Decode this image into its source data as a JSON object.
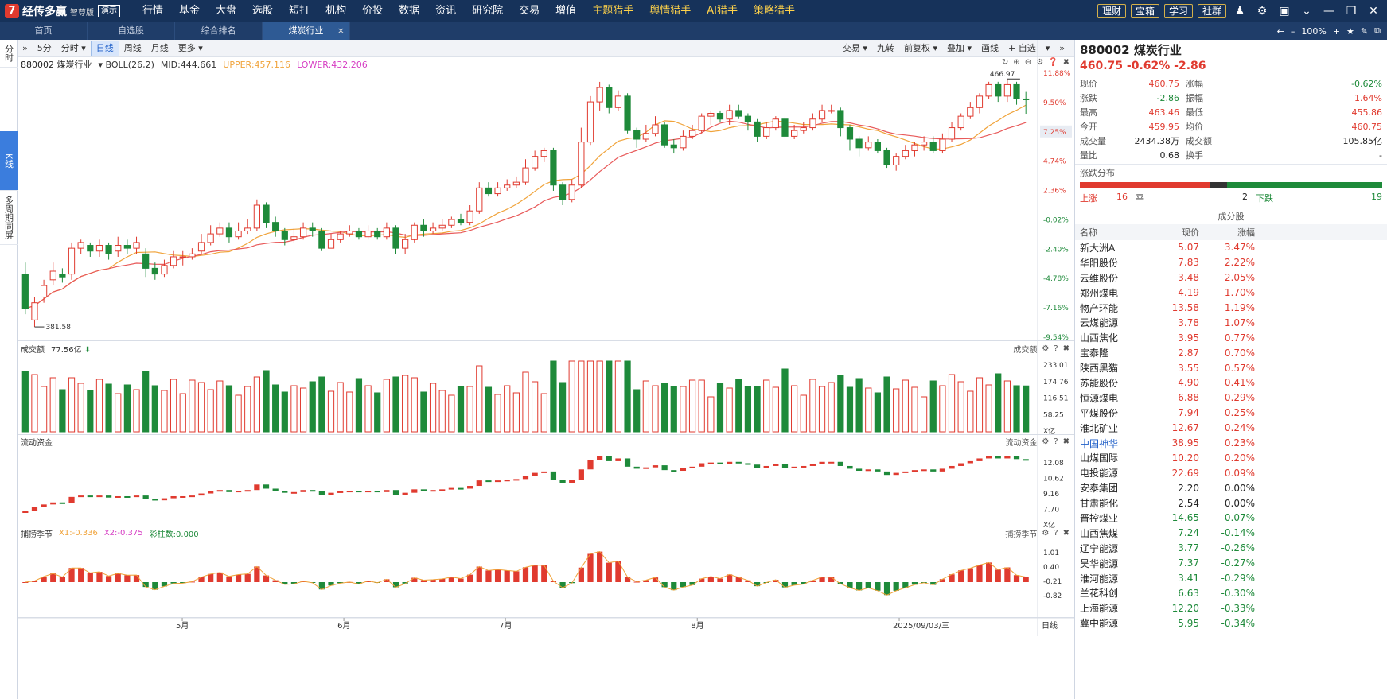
{
  "app": {
    "logo_glyph": "7",
    "name": "经传多赢",
    "edition": "智尊版",
    "demo_badge": "演示"
  },
  "nav": [
    "行情",
    "基金",
    "大盘",
    "选股",
    "短打",
    "机构",
    "价投",
    "数据",
    "资讯",
    "研究院",
    "交易",
    "增值",
    "主题猎手",
    "舆情猎手",
    "AI猎手",
    "策略猎手"
  ],
  "nav_highlight": [
    "主题猎手",
    "舆情猎手",
    "AI猎手",
    "策略猎手"
  ],
  "top_buttons": [
    "理财",
    "宝箱",
    "学习",
    "社群"
  ],
  "tabs": [
    {
      "label": "首页"
    },
    {
      "label": "自选股"
    },
    {
      "label": "综合排名"
    },
    {
      "label": "煤炭行业",
      "active": true
    }
  ],
  "tab_tools": {
    "zoom": "100%"
  },
  "left_side": [
    "分时",
    "K线",
    "多周期同屏"
  ],
  "chart_toolbar": {
    "left": [
      "»",
      "5分",
      "分时 ▾",
      "日线",
      "周线",
      "月线",
      "更多 ▾"
    ],
    "active": "日线",
    "right": [
      "交易 ▾",
      "九转",
      "前复权 ▾",
      "叠加 ▾",
      "画线",
      "+ 自选",
      "▾",
      "»"
    ]
  },
  "indicator": {
    "name": "880002 煤炭行业",
    "boll": "BOLL(26,2)",
    "mid": "MID:444.661",
    "upper": "UPPER:457.116",
    "lower": "LOWER:432.206"
  },
  "price_axis": [
    "11.88%",
    "9.50%",
    "7.25%",
    "4.74%",
    "2.36%",
    "-0.02%",
    "-2.40%",
    "-4.78%",
    "-7.16%",
    "-9.54%"
  ],
  "price_markers": {
    "high": "466.97",
    "low": "381.58"
  },
  "vol_panel": {
    "title": "成交额",
    "value": "77.56亿",
    "axis": [
      "233.01",
      "174.76",
      "116.51",
      "58.25",
      "X亿"
    ],
    "right_label": "成交额"
  },
  "flow_panel": {
    "title": "流动资金",
    "axis": [
      "12.08",
      "10.62",
      "9.16",
      "7.70",
      "X亿"
    ],
    "right_label": "流动资金"
  },
  "season_panel": {
    "title": "捕捞季节",
    "x1": "X1:-0.336",
    "x2": "X2:-0.375",
    "bar": "彩柱数:0.000",
    "axis": [
      "1.01",
      "0.40",
      "-0.21",
      "-0.82"
    ],
    "right_label": "捕捞季节"
  },
  "date_axis": [
    "5月",
    "6月",
    "7月",
    "8月",
    "2025/09/03/三"
  ],
  "period_label": "日线",
  "colors": {
    "up": "#e03a2f",
    "down": "#1e8a3a",
    "ma_orange": "#f0a33a",
    "ma_red": "#e85a5a",
    "accent": "#1f5fc8"
  },
  "right_panel": {
    "code_name": "880002 煤炭行业",
    "price_line": "460.75  -0.62%  -2.86",
    "quote": [
      {
        "k": "现价",
        "v": "460.75",
        "k2": "涨幅",
        "v2": "-0.62%"
      },
      {
        "k": "涨跌",
        "v": "-2.86",
        "k2": "振幅",
        "v2": "1.64%"
      },
      {
        "k": "最高",
        "v": "463.46",
        "k2": "最低",
        "v2": "455.86"
      },
      {
        "k": "今开",
        "v": "459.95",
        "k2": "均价",
        "v2": "460.75"
      },
      {
        "k": "成交量",
        "v": "2434.38万",
        "k2": "成交额",
        "v2": "105.85亿"
      },
      {
        "k": "量比",
        "v": "0.68",
        "k2": "换手",
        "v2": "-"
      }
    ],
    "dist_title": "涨跌分布",
    "dist": {
      "up_label": "上涨",
      "up": "16",
      "flat_label": "平",
      "flat": "2",
      "down_label": "下跌",
      "down": "19"
    },
    "comp_title": "成分股",
    "comp_cols": [
      "名称",
      "现价",
      "涨幅"
    ],
    "components": [
      {
        "name": "新大洲A",
        "price": "5.07",
        "chg": "3.47%"
      },
      {
        "name": "华阳股份",
        "price": "7.83",
        "chg": "2.22%"
      },
      {
        "name": "云维股份",
        "price": "3.48",
        "chg": "2.05%"
      },
      {
        "name": "郑州煤电",
        "price": "4.19",
        "chg": "1.70%"
      },
      {
        "name": "物产环能",
        "price": "13.58",
        "chg": "1.19%"
      },
      {
        "name": "云煤能源",
        "price": "3.78",
        "chg": "1.07%"
      },
      {
        "name": "山西焦化",
        "price": "3.95",
        "chg": "0.77%"
      },
      {
        "name": "宝泰隆",
        "price": "2.87",
        "chg": "0.70%"
      },
      {
        "name": "陕西黑猫",
        "price": "3.55",
        "chg": "0.57%"
      },
      {
        "name": "苏能股份",
        "price": "4.90",
        "chg": "0.41%"
      },
      {
        "name": "恒源煤电",
        "price": "6.88",
        "chg": "0.29%"
      },
      {
        "name": "平煤股份",
        "price": "7.94",
        "chg": "0.25%"
      },
      {
        "name": "淮北矿业",
        "price": "12.67",
        "chg": "0.24%"
      },
      {
        "name": "中国神华",
        "price": "38.95",
        "chg": "0.23%",
        "hl": true
      },
      {
        "name": "山煤国际",
        "price": "10.20",
        "chg": "0.20%"
      },
      {
        "name": "电投能源",
        "price": "22.69",
        "chg": "0.09%"
      },
      {
        "name": "安泰集团",
        "price": "2.20",
        "chg": "0.00%"
      },
      {
        "name": "甘肃能化",
        "price": "2.54",
        "chg": "0.00%"
      },
      {
        "name": "晋控煤业",
        "price": "14.65",
        "chg": "-0.07%"
      },
      {
        "name": "山西焦煤",
        "price": "7.24",
        "chg": "-0.14%"
      },
      {
        "name": "辽宁能源",
        "price": "3.77",
        "chg": "-0.26%"
      },
      {
        "name": "昊华能源",
        "price": "7.37",
        "chg": "-0.27%"
      },
      {
        "name": "淮河能源",
        "price": "3.41",
        "chg": "-0.29%"
      },
      {
        "name": "兰花科创",
        "price": "6.63",
        "chg": "-0.30%"
      },
      {
        "name": "上海能源",
        "price": "12.20",
        "chg": "-0.33%"
      },
      {
        "name": "冀中能源",
        "price": "5.95",
        "chg": "-0.34%"
      }
    ]
  },
  "chart_data": {
    "type": "candlestick",
    "title": "880002 煤炭行业",
    "period": "日线",
    "high": 466.97,
    "low": 381.58,
    "candles": [
      [
        400,
        388,
        404,
        386
      ],
      [
        384,
        390,
        392,
        381.58
      ],
      [
        392,
        396,
        398,
        390
      ],
      [
        398,
        401,
        404,
        396
      ],
      [
        400,
        399,
        402,
        397
      ],
      [
        400,
        409,
        411,
        398
      ],
      [
        409,
        411,
        412,
        407
      ],
      [
        410,
        408,
        411,
        406
      ],
      [
        408,
        410,
        412,
        406
      ],
      [
        410,
        407,
        411,
        405
      ],
      [
        408,
        410,
        413,
        406
      ],
      [
        410,
        409,
        412,
        407
      ],
      [
        409,
        411,
        413,
        407
      ],
      [
        407,
        402,
        409,
        399
      ],
      [
        402,
        400,
        404,
        398
      ],
      [
        400,
        403,
        405,
        399
      ],
      [
        403,
        406,
        408,
        402
      ],
      [
        406,
        406,
        408,
        403
      ],
      [
        406,
        407,
        409,
        405
      ],
      [
        408,
        411,
        414,
        407
      ],
      [
        411,
        414,
        417,
        410
      ],
      [
        414,
        416,
        418,
        413
      ],
      [
        416,
        413,
        418,
        411
      ],
      [
        413,
        415,
        418,
        412
      ],
      [
        415,
        416,
        419,
        414
      ],
      [
        416,
        424,
        426,
        415
      ],
      [
        424,
        418,
        425,
        416
      ],
      [
        418,
        415,
        420,
        413
      ],
      [
        415,
        412,
        416,
        410
      ],
      [
        412,
        413,
        416,
        411
      ],
      [
        413,
        416,
        418,
        412
      ],
      [
        416,
        415,
        418,
        413
      ],
      [
        415,
        409,
        416,
        408
      ],
      [
        409,
        412,
        414,
        410
      ],
      [
        412,
        414,
        415,
        411
      ],
      [
        414,
        415,
        417,
        413
      ],
      [
        415,
        413,
        416,
        412
      ],
      [
        413,
        415,
        417,
        412
      ],
      [
        415,
        413,
        416,
        412
      ],
      [
        413,
        416,
        418,
        412
      ],
      [
        416,
        409,
        417,
        407
      ],
      [
        409,
        412,
        414,
        407
      ],
      [
        412,
        417,
        418,
        411
      ],
      [
        417,
        415,
        419,
        413
      ],
      [
        415,
        416,
        418,
        414
      ],
      [
        416,
        417,
        419,
        415
      ],
      [
        417,
        419,
        420,
        416
      ],
      [
        419,
        418,
        421,
        417
      ],
      [
        418,
        422,
        424,
        417
      ],
      [
        422,
        430,
        432,
        421
      ],
      [
        430,
        428,
        432,
        427
      ],
      [
        428,
        430,
        432,
        427
      ],
      [
        430,
        431,
        433,
        429
      ],
      [
        431,
        432,
        434,
        430
      ],
      [
        432,
        437,
        440,
        431
      ],
      [
        437,
        441,
        443,
        436
      ],
      [
        441,
        443,
        444,
        439
      ],
      [
        443,
        431,
        444,
        429
      ],
      [
        431,
        426,
        432,
        424
      ],
      [
        426,
        431,
        433,
        425
      ],
      [
        431,
        446,
        451,
        430
      ],
      [
        446,
        460,
        462,
        445
      ],
      [
        460,
        465,
        466.97,
        457
      ],
      [
        465,
        458,
        466,
        456
      ],
      [
        458,
        462,
        464,
        457
      ],
      [
        462,
        450,
        463,
        449
      ],
      [
        450,
        447,
        451,
        444
      ],
      [
        447,
        449,
        452,
        446
      ],
      [
        449,
        452,
        455,
        448
      ],
      [
        452,
        445,
        453,
        444
      ],
      [
        445,
        444,
        447,
        442
      ],
      [
        444,
        448,
        450,
        443
      ],
      [
        448,
        450,
        452,
        447
      ],
      [
        450,
        455,
        456,
        449
      ],
      [
        455,
        456,
        457,
        452
      ],
      [
        456,
        454,
        457,
        453
      ],
      [
        454,
        457,
        459,
        452
      ],
      [
        457,
        455,
        459,
        454
      ],
      [
        455,
        453,
        456,
        450
      ],
      [
        453,
        448,
        454,
        446
      ],
      [
        448,
        451,
        453,
        447
      ],
      [
        451,
        454,
        455,
        450
      ],
      [
        454,
        448,
        455,
        447
      ],
      [
        448,
        450,
        452,
        447
      ],
      [
        450,
        451,
        453,
        449
      ],
      [
        451,
        454,
        456,
        450
      ],
      [
        454,
        457,
        459,
        453
      ],
      [
        457,
        457,
        459,
        456
      ],
      [
        457,
        451,
        458,
        448
      ],
      [
        451,
        447,
        452,
        443
      ],
      [
        447,
        444,
        448,
        441
      ],
      [
        444,
        446,
        448,
        443
      ],
      [
        446,
        443,
        447,
        442
      ],
      [
        443,
        438,
        444,
        437
      ],
      [
        438,
        441,
        442,
        436
      ],
      [
        441,
        443,
        445,
        440
      ],
      [
        443,
        445,
        446,
        441
      ],
      [
        445,
        446,
        448,
        443
      ],
      [
        446,
        443,
        448,
        442
      ],
      [
        443,
        447,
        449,
        442
      ],
      [
        447,
        451,
        453,
        446
      ],
      [
        451,
        455,
        456,
        450
      ],
      [
        455,
        458,
        460,
        454
      ],
      [
        458,
        462,
        463,
        456
      ],
      [
        462,
        466,
        467,
        461
      ],
      [
        466,
        462,
        467,
        460
      ],
      [
        462,
        466,
        468,
        460
      ],
      [
        466,
        461,
        467,
        459
      ],
      [
        461,
        460.75,
        463.46,
        455.86
      ]
    ],
    "volume_unit": "亿",
    "volume_last": 77.56
  }
}
